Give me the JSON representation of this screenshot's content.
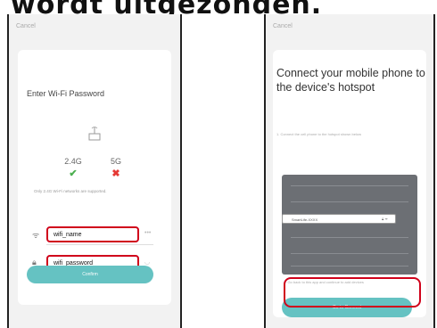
{
  "heading": "wordt uitgezonden.",
  "left_screen": {
    "cancel_label": "Cancel",
    "title": "Enter Wi-Fi Password",
    "bands": [
      {
        "label": "2.4G",
        "supported": true
      },
      {
        "label": "5G",
        "supported": false
      }
    ],
    "note": "Only 2.4G Wi-Fi networks are supported.",
    "wifi_name": "wifi_name",
    "wifi_password": "wifi_password",
    "change_label": "•••",
    "confirm_label": "Confirm",
    "highlight_color": "#d0021b"
  },
  "right_screen": {
    "cancel_label": "Cancel",
    "title": "Connect your mobile phone to the device's hotspot",
    "step1": "1. Connect the cell phone to the hotspot shown below",
    "hotspot_name": "SmartLife-XXXX",
    "step2": "2. Go back to this app and continue to add devices",
    "connect_label": "Go to Connect",
    "accent_color": "#65c2c2"
  }
}
